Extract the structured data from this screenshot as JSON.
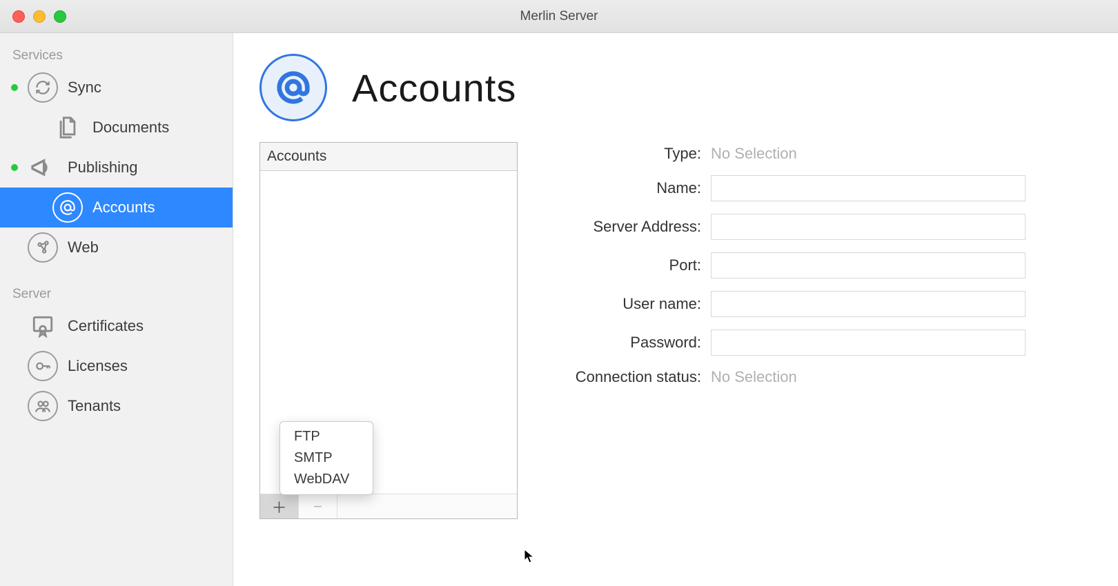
{
  "window": {
    "title": "Merlin Server"
  },
  "sidebar": {
    "sections": [
      {
        "label": "Services",
        "items": [
          {
            "label": "Sync",
            "icon": "sync-icon",
            "dot": true
          },
          {
            "label": "Documents",
            "icon": "documents-icon",
            "indent": true
          },
          {
            "label": "Publishing",
            "icon": "megaphone-icon",
            "dot": true
          },
          {
            "label": "Accounts",
            "icon": "at-icon",
            "indent": true,
            "selected": true
          },
          {
            "label": "Web",
            "icon": "web-icon"
          }
        ]
      },
      {
        "label": "Server",
        "items": [
          {
            "label": "Certificates",
            "icon": "certificate-icon"
          },
          {
            "label": "Licenses",
            "icon": "key-icon"
          },
          {
            "label": "Tenants",
            "icon": "tenants-icon"
          }
        ]
      }
    ]
  },
  "page": {
    "title": "Accounts"
  },
  "accounts_list": {
    "header": "Accounts"
  },
  "popup": {
    "items": [
      "FTP",
      "SMTP",
      "WebDAV"
    ]
  },
  "form": {
    "type_label": "Type:",
    "type_value": "No Selection",
    "name_label": "Name:",
    "name_value": "",
    "server_label": "Server Address:",
    "server_value": "",
    "port_label": "Port:",
    "port_value": "",
    "user_label": "User name:",
    "user_value": "",
    "password_label": "Password:",
    "password_value": "",
    "status_label": "Connection status:",
    "status_value": "No Selection"
  }
}
